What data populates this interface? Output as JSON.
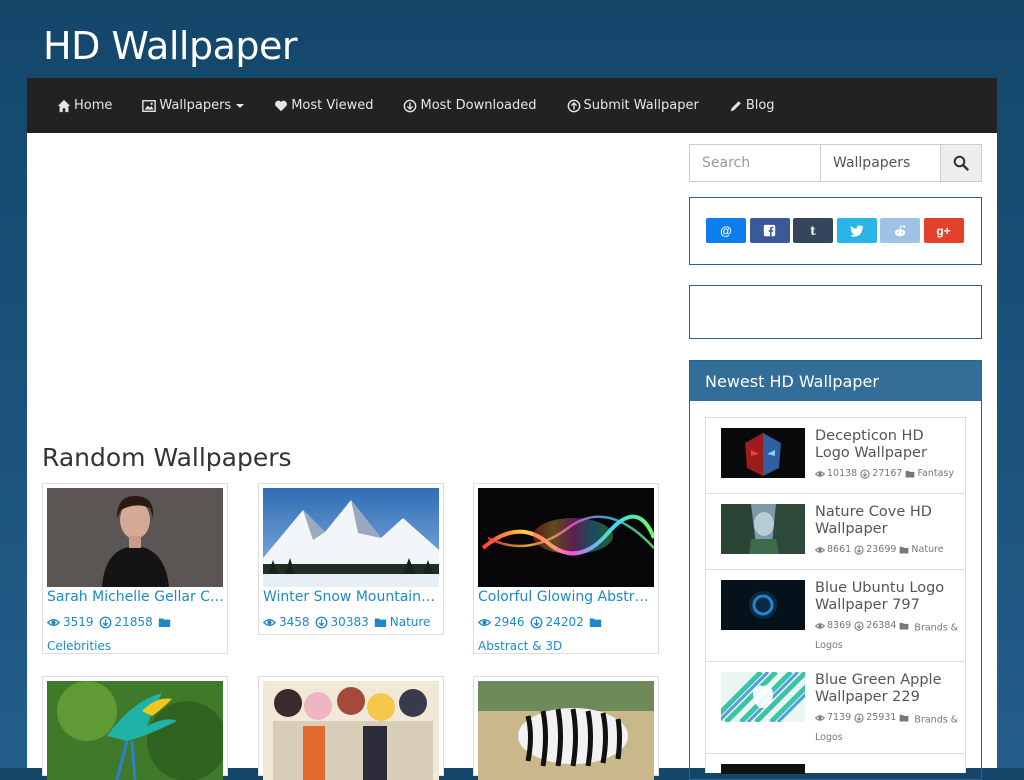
{
  "site": {
    "title": "HD Wallpaper"
  },
  "nav": {
    "items": [
      {
        "label": "Home",
        "icon": "home-icon"
      },
      {
        "label": "Wallpapers",
        "icon": "picture-icon",
        "dropdown": true
      },
      {
        "label": "Most Viewed",
        "icon": "heart-icon"
      },
      {
        "label": "Most Downloaded",
        "icon": "download-circle-icon"
      },
      {
        "label": "Submit Wallpaper",
        "icon": "upload-circle-icon"
      },
      {
        "label": "Blog",
        "icon": "pencil-icon"
      }
    ]
  },
  "main": {
    "section_title": "Random Wallpapers",
    "cards": [
      {
        "title": "Sarah Michelle Gellar Ce...",
        "views": "3519",
        "downloads": "21858",
        "category": "Celebrities"
      },
      {
        "title": "Winter Snow Mountains...",
        "views": "3458",
        "downloads": "30383",
        "category": "Nature"
      },
      {
        "title": "Colorful Glowing Abstra...",
        "views": "2946",
        "downloads": "24202",
        "category": "Abstract & 3D"
      }
    ]
  },
  "sidebar": {
    "search": {
      "placeholder": "Search",
      "select_value": "Wallpapers"
    },
    "share_buttons": [
      {
        "name": "email",
        "glyph": "@",
        "color": "#0d7ef0"
      },
      {
        "name": "facebook",
        "glyph": "f",
        "color": "#3b5998"
      },
      {
        "name": "tumblr",
        "glyph": "t",
        "color": "#35465c"
      },
      {
        "name": "twitter",
        "glyph": "t",
        "color": "#29b5e8"
      },
      {
        "name": "reddit",
        "glyph": "r",
        "color": "#9ec3e6"
      },
      {
        "name": "google-plus",
        "glyph": "g+",
        "color": "#e4412d"
      }
    ],
    "newest": {
      "title": "Newest HD Wallpaper",
      "items": [
        {
          "title": "Decepticon HD Logo Wallpaper",
          "views": "10138",
          "downloads": "27167",
          "category": "Fantasy"
        },
        {
          "title": "Nature Cove HD Wallpaper",
          "views": "8661",
          "downloads": "23699",
          "category": "Nature"
        },
        {
          "title": "Blue Ubuntu Logo Wallpaper 797",
          "views": "8369",
          "downloads": "26384",
          "category": "Brands & Logos"
        },
        {
          "title": "Blue Green Apple Wallpaper 229",
          "views": "7139",
          "downloads": "25931",
          "category": "Brands & Logos"
        }
      ]
    }
  }
}
